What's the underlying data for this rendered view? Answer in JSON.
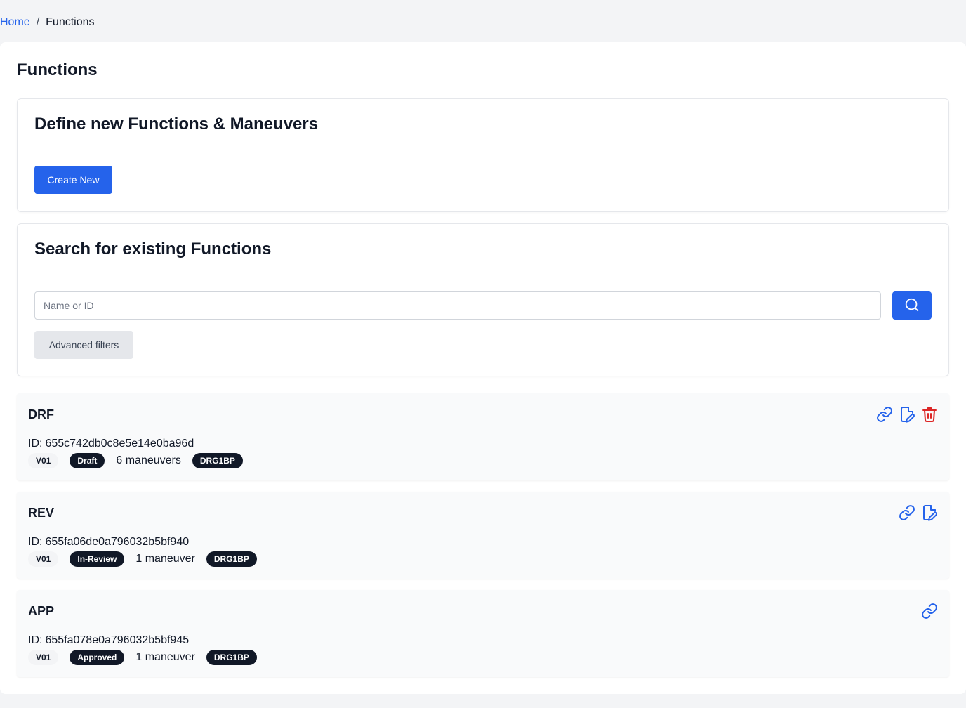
{
  "breadcrumb": {
    "home": "Home",
    "separator": "/",
    "current": "Functions"
  },
  "page_title": "Functions",
  "define_section": {
    "title": "Define new Functions & Maneuvers",
    "create_button": "Create New"
  },
  "search_section": {
    "title": "Search for existing Functions",
    "placeholder": "Name or ID",
    "value": "",
    "search_icon": "search-icon",
    "advanced_filters_button": "Advanced filters"
  },
  "results": [
    {
      "name": "DRF",
      "id_prefix": "ID:",
      "id": "655c742db0c8e5e14e0ba96d",
      "version": "V01",
      "status": "Draft",
      "maneuvers": "6 maneuvers",
      "tag": "DRG1BP",
      "actions": [
        "link-icon",
        "edit-document-icon",
        "trash-icon"
      ]
    },
    {
      "name": "REV",
      "id_prefix": "ID:",
      "id": "655fa06de0a796032b5bf940",
      "version": "V01",
      "status": "In-Review",
      "maneuvers": "1 maneuver",
      "tag": "DRG1BP",
      "actions": [
        "link-icon",
        "edit-document-icon"
      ]
    },
    {
      "name": "APP",
      "id_prefix": "ID:",
      "id": "655fa078e0a796032b5bf945",
      "version": "V01",
      "status": "Approved",
      "maneuvers": "1 maneuver",
      "tag": "DRG1BP",
      "actions": [
        "link-icon"
      ]
    }
  ],
  "colors": {
    "primary": "#2563eb",
    "danger": "#dc2626",
    "badge_dark": "#111827",
    "background": "#f3f4f6"
  }
}
